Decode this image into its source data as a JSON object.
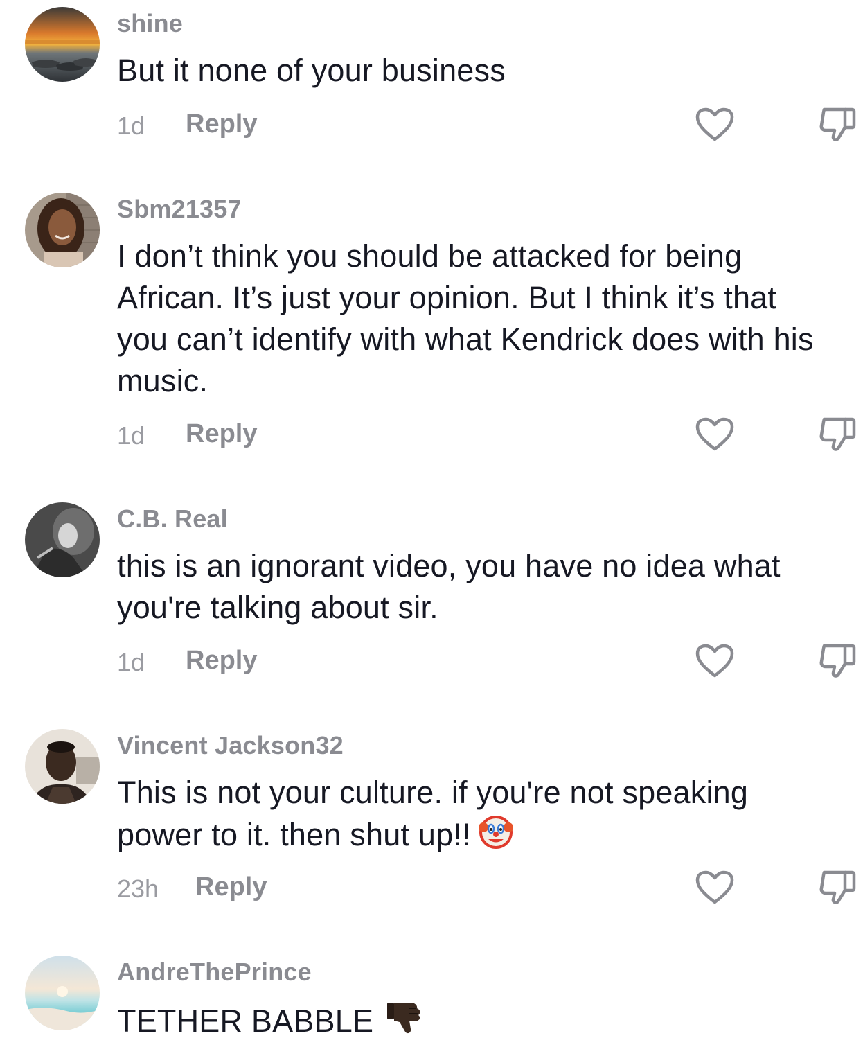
{
  "comments": [
    {
      "username": "shine",
      "text": "But it none of your business",
      "time": "1d",
      "reply_label": "Reply",
      "avatar_icon": "sunset-boats-avatar"
    },
    {
      "username": "Sbm21357",
      "text": "I don’t think you should be attacked for being\nAfrican. It’s just your opinion. But I think it’s that\nyou can’t identify with what Kendrick does with his\nmusic.",
      "time": "1d",
      "reply_label": "Reply",
      "avatar_icon": "woman-curly-hair-avatar"
    },
    {
      "username": "C.B. Real",
      "text": "this is an ignorant video, you have no idea what\nyou're talking about sir.",
      "time": "1d",
      "reply_label": "Reply",
      "avatar_icon": "grayscale-portrait-avatar"
    },
    {
      "username": "Vincent Jackson32",
      "text": "This is not your culture. if you're not speaking\npower to it. then shut up!!",
      "time": "23h",
      "reply_label": "Reply",
      "avatar_icon": "man-portrait-avatar",
      "trailing_emoji": "clown-face-emoji"
    },
    {
      "username": "AndreThePrince",
      "text": "TETHER BABBLE",
      "avatar_icon": "beach-avatar",
      "trailing_emoji": "thumbs-down-emoji"
    }
  ],
  "colors": {
    "username": "#8a8b91",
    "text": "#161823",
    "time": "#9a9ba1",
    "icon_stroke": "#8a8b91",
    "background": "#ffffff"
  },
  "icons": {
    "like": "heart-outline-icon",
    "dislike": "thumbs-down-outline-icon"
  }
}
